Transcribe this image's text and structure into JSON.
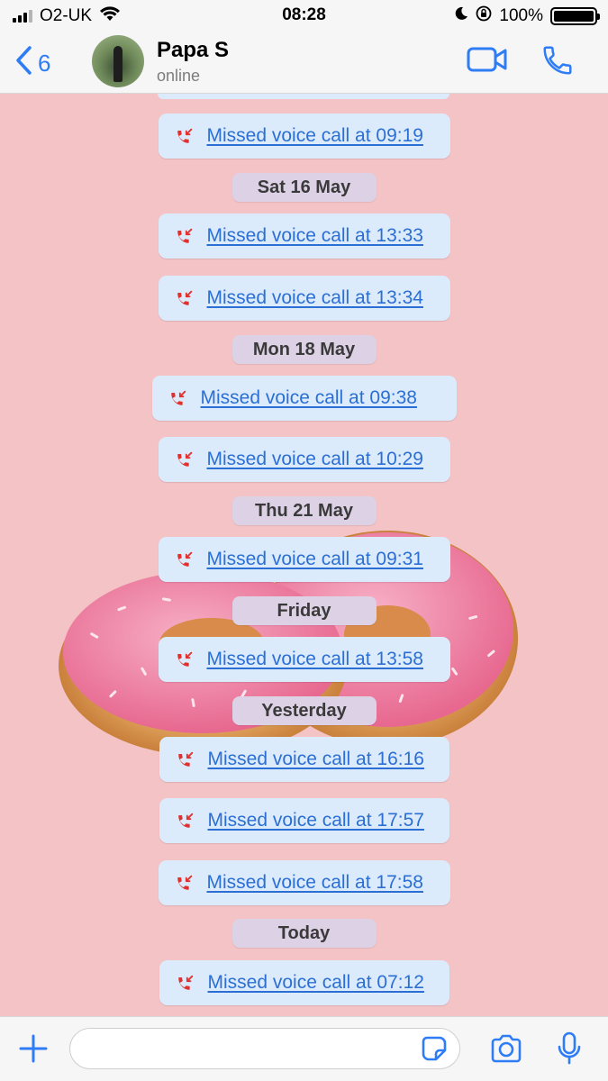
{
  "status_bar": {
    "carrier": "O2-UK",
    "time": "08:28",
    "battery": "100%",
    "icons": [
      "signal-icon",
      "wifi-icon",
      "moon-icon",
      "rotation-lock-icon",
      "battery-icon"
    ]
  },
  "header": {
    "back_count": "6",
    "contact_name": "Papa S",
    "contact_status": "online",
    "icons": [
      "chevron-left-icon",
      "video-call-icon",
      "phone-icon"
    ]
  },
  "chat": {
    "items": [
      {
        "type": "call",
        "text": "Missed voice call at 09:19"
      },
      {
        "type": "date",
        "text": "Sat 16 May"
      },
      {
        "type": "call",
        "text": "Missed voice call at 13:33"
      },
      {
        "type": "call",
        "text": "Missed voice call at 13:34"
      },
      {
        "type": "date",
        "text": "Mon 18 May"
      },
      {
        "type": "call",
        "text": "Missed voice call at 09:38"
      },
      {
        "type": "call",
        "text": "Missed voice call at 10:29"
      },
      {
        "type": "date",
        "text": "Thu 21 May"
      },
      {
        "type": "call",
        "text": "Missed voice call at 09:31"
      },
      {
        "type": "date",
        "text": "Friday"
      },
      {
        "type": "call",
        "text": "Missed voice call at 13:58"
      },
      {
        "type": "date",
        "text": "Yesterday"
      },
      {
        "type": "call",
        "text": "Missed voice call at 16:16"
      },
      {
        "type": "call",
        "text": "Missed voice call at 17:57"
      },
      {
        "type": "call",
        "text": "Missed voice call at 17:58"
      },
      {
        "type": "date",
        "text": "Today"
      },
      {
        "type": "call",
        "text": "Missed voice call at 07:12"
      }
    ]
  },
  "input_bar": {
    "placeholder": "",
    "icons": [
      "plus-icon",
      "sticker-icon",
      "camera-icon",
      "microphone-icon"
    ]
  },
  "colors": {
    "wallpaper": "#f3c3c6",
    "accent": "#2e7cf6",
    "missed_call": "#e0312f",
    "call_bubble": "#dcebfb",
    "date_pill": "#ddd1e6"
  }
}
